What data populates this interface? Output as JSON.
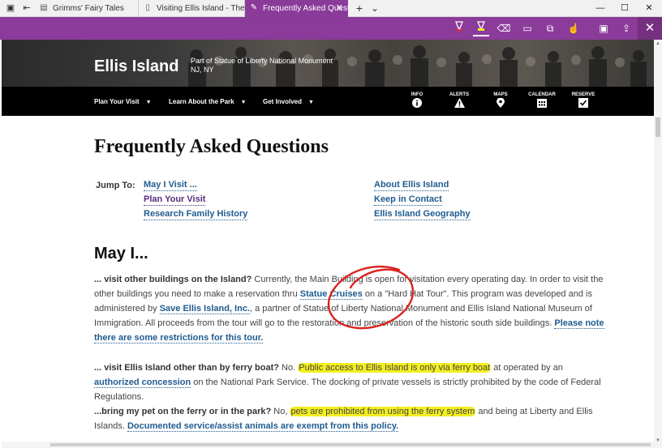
{
  "tabs": [
    {
      "title": "Grimms' Fairy Tales",
      "icon": "book-icon"
    },
    {
      "title": "Visiting Ellis Island - The Sta",
      "icon": "reading-view-icon"
    },
    {
      "title": "Frequently Asked Quest",
      "icon": "pen-icon",
      "active": true
    }
  ],
  "tabbar": {
    "new_tab": "+",
    "tabs_menu": "⌄",
    "close": "✕"
  },
  "window": {
    "minimize": "—",
    "maximize": "☐",
    "close": "✕"
  },
  "ink_toolbar": {
    "tools": [
      "ballpoint-pen",
      "highlighter",
      "eraser",
      "add-note",
      "clip",
      "touch-writing",
      "save",
      "share"
    ],
    "close": "✕",
    "colors": {
      "bar": "#8b3b9a",
      "pen": "#e03030",
      "highlighter": "#f3ee1f"
    }
  },
  "hero": {
    "title": "Ellis Island",
    "subtitle_line1": "Part of Statue of Liberty National Monument",
    "subtitle_line2": "NJ, NY"
  },
  "nav": {
    "items": [
      "Plan Your Visit",
      "Learn About the Park",
      "Get Involved"
    ],
    "icons": [
      {
        "label": "INFO",
        "icon": "info-icon"
      },
      {
        "label": "ALERTS",
        "icon": "alert-icon"
      },
      {
        "label": "MAPS",
        "icon": "map-pin-icon"
      },
      {
        "label": "CALENDAR",
        "icon": "calendar-icon"
      },
      {
        "label": "RESERVE",
        "icon": "checkbox-icon"
      }
    ]
  },
  "page": {
    "title": "Frequently Asked Questions",
    "jump_to_label": "Jump To:",
    "jump_links": {
      "may_i_visit": "May I Visit ...",
      "plan_your_visit": "Plan Your Visit",
      "research_family_history": "Research Family History",
      "about_ellis_island": "About Ellis Island",
      "keep_in_contact": "Keep in Contact",
      "ellis_island_geography": "Ellis Island Geography"
    },
    "section_heading": "May I...",
    "faq1": {
      "question": "... visit other buildings on the Island?",
      "text1": " Currently, the Main Building is open for visitation every operating day. In order to visit the other buildings you need to make a reservation thru ",
      "link1": "Statue Cruises",
      "text2": " on a \"Hard Hat Tour\". This program was developed and is administered by ",
      "link2": "Save Ellis Island, Inc.",
      "text3": ", a partner of Statue of Liberty National Monument and Ellis Island National Museum of Immigration. All proceeds from the tour will go to the restoration and preservation of the historic south side buildings. ",
      "link3": "Please note there are some restrictions for this tour."
    },
    "faq2": {
      "question": "... visit Ellis Island other than by ferry boat?",
      "text1": " No. ",
      "highlight": "Public access to Ellis Island is only via ferry boat",
      "text2": " at operated by an ",
      "link1": "authorized concession",
      "text3": " on the National Park Service. The docking of private vessels is strictly prohibited by the code of Federal Regulations."
    },
    "faq3": {
      "question": "...bring my pet on the ferry or in the park?",
      "text1": " No, ",
      "highlight": "pets are prohibited from using the ferry system",
      "text2": " and being at Liberty and Ellis Islands. ",
      "link1": "Documented service/assist animals are exempt from this policy."
    }
  }
}
